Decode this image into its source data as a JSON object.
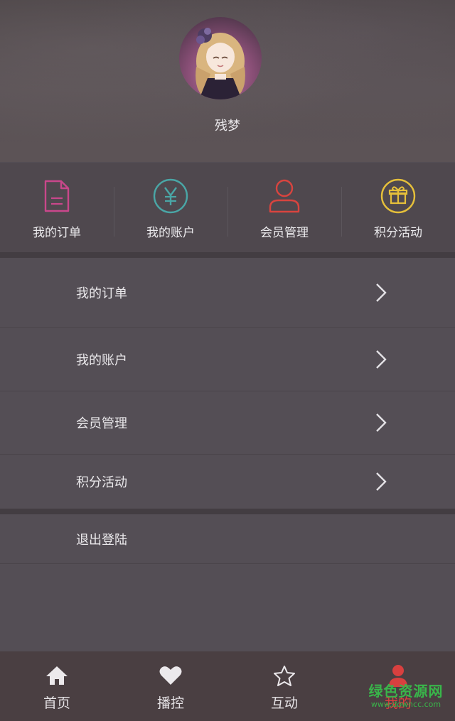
{
  "profile": {
    "username": "残梦"
  },
  "quick_actions": [
    {
      "label": "我的订单",
      "icon": "document-icon",
      "color": "#c9478b"
    },
    {
      "label": "我的账户",
      "icon": "yuan-icon",
      "color": "#4aa6a6"
    },
    {
      "label": "会员管理",
      "icon": "user-icon",
      "color": "#d9443f"
    },
    {
      "label": "积分活动",
      "icon": "gift-icon",
      "color": "#e6c03a"
    }
  ],
  "menu": [
    {
      "label": "我的订单"
    },
    {
      "label": "我的账户"
    },
    {
      "label": "会员管理"
    },
    {
      "label": "积分活动"
    }
  ],
  "logout_label": "退出登陆",
  "tabs": [
    {
      "label": "首页",
      "icon": "home-icon"
    },
    {
      "label": "播控",
      "icon": "heart-icon"
    },
    {
      "label": "互动",
      "icon": "star-icon"
    },
    {
      "label": "我的",
      "icon": "person-icon",
      "active": true
    }
  ],
  "active_color": "#d8403f",
  "watermark": {
    "line1": "绿色资源网",
    "line2": "www.downcc.com"
  }
}
